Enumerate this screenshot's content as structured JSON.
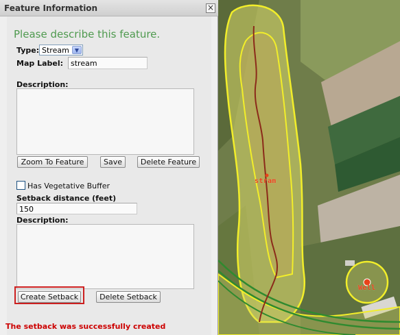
{
  "window": {
    "title": "Feature Information",
    "close_glyph": "×"
  },
  "form": {
    "heading": "Please describe this feature.",
    "type_label": "Type:",
    "type_value": "Stream",
    "type_dropdown_icon": "chevron-down-icon",
    "map_label_label": "Map Label:",
    "map_label_value": "stream",
    "description_label": "Description:",
    "description_value": "",
    "buttons": {
      "zoom": "Zoom To Feature",
      "save": "Save",
      "delete_feature": "Delete Feature"
    }
  },
  "setback": {
    "buffer_checkbox_label": "Has Vegetative Buffer",
    "buffer_checked": false,
    "distance_label": "Setback distance (feet)",
    "distance_value": "150",
    "description_label": "Description:",
    "description_value": "",
    "buttons": {
      "create": "Create Setback",
      "delete": "Delete Setback"
    }
  },
  "status": {
    "message": "The setback was successfully created",
    "color": "#cc0000"
  },
  "map": {
    "labels": {
      "stream": "stram",
      "well": "Well"
    },
    "colors": {
      "setback_outline": "#f2ee2a",
      "stream_line": "#8b2a1a",
      "well_marker": "#e8431a",
      "power_lines": "#2f8a2f"
    }
  }
}
